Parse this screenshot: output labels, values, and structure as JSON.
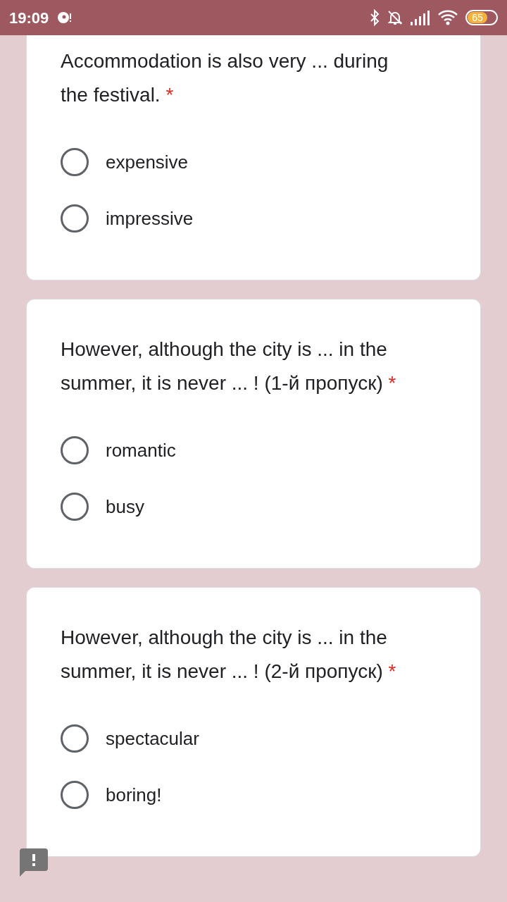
{
  "status_bar": {
    "time": "19:09",
    "battery": "65"
  },
  "questions": [
    {
      "text": "Accommodation is also very ... during the festival.",
      "required_mark": "*",
      "cut_top": true,
      "options": [
        {
          "label": "expensive",
          "selected": false
        },
        {
          "label": "impressive",
          "selected": false
        }
      ]
    },
    {
      "text": "However, although the city is ... in the summer, it is never ... ! (1-й пропуск)",
      "required_mark": "*",
      "cut_top": false,
      "options": [
        {
          "label": "romantic",
          "selected": false
        },
        {
          "label": "busy",
          "selected": false
        }
      ]
    },
    {
      "text": "However, although the city is ... in the summer, it is never ... ! (2-й пропуск)",
      "required_mark": "*",
      "cut_top": false,
      "options": [
        {
          "label": "spectacular",
          "selected": false
        },
        {
          "label": "boring!",
          "selected": false
        }
      ]
    }
  ]
}
